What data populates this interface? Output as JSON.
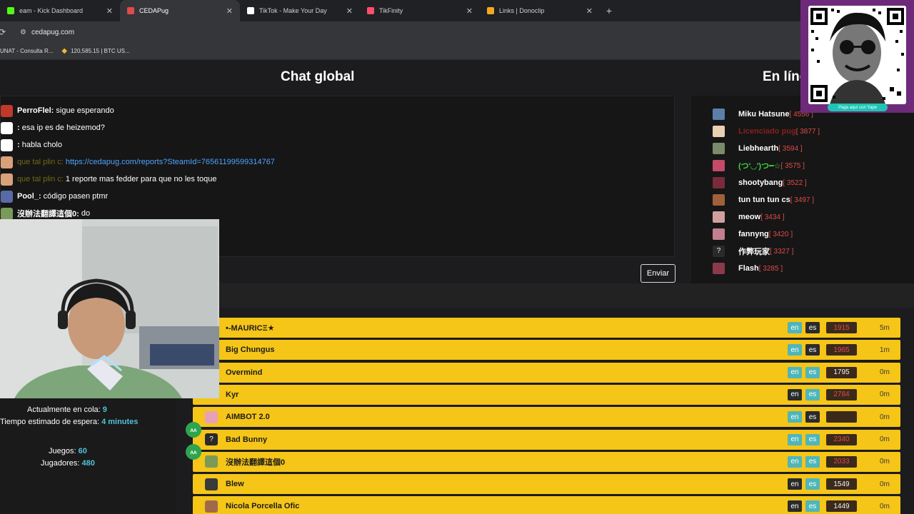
{
  "tabs": [
    {
      "label": "eam - Kick Dashboard",
      "icon": "kick-icon",
      "color": "#53fc18"
    },
    {
      "label": "CEDAPug",
      "icon": "cedapug-icon",
      "color": "#e04a4a",
      "active": true
    },
    {
      "label": "TikTok - Make Your Day",
      "icon": "tiktok-icon",
      "color": "#ffffff"
    },
    {
      "label": "TikFinity",
      "icon": "tikfinity-icon",
      "color": "#ff4d6d"
    },
    {
      "label": "Links | Donoclip",
      "icon": "donoclip-icon",
      "color": "#f5a623"
    }
  ],
  "toolbar": {
    "url": "cedapug.com"
  },
  "bookmarks": [
    {
      "label": "UNAT - Consulta R..."
    },
    {
      "label": "120,585.15 | BTC US...",
      "icon": "binance-icon"
    }
  ],
  "chat": {
    "title": "Chat global",
    "send_label": "Enviar",
    "messages": [
      {
        "user": "PerroFlel:",
        "text": " sigue esperando",
        "avatar_color": "#c0392b"
      },
      {
        "user": ":",
        "text": " esa ip es de heizemod?",
        "avatar_color": "#ffffff"
      },
      {
        "user": ":",
        "text": " habla cholo",
        "avatar_color": "#ffffff"
      },
      {
        "user": "que tal plin c:",
        "text": " https://cedapug.com/reports?SteamId=76561199599314767",
        "avatar_color": "#d9a17a",
        "olive": true,
        "link": true
      },
      {
        "user": "que tal plin c:",
        "text": " 1 reporte mas fedder para que no les toque",
        "avatar_color": "#d9a17a",
        "olive": true
      },
      {
        "user": "Pool_:",
        "text": " código pasen ptmr",
        "avatar_color": "#5a6aa8"
      },
      {
        "user": "沒辦法翻譯這個0:",
        "text": " do",
        "avatar_color": "#7a9a5a"
      }
    ]
  },
  "online": {
    "title": "En líne",
    "users": [
      {
        "name": "Miku Hatsune",
        "score": "[ 4556 ]",
        "color": "#ffffff",
        "avatar_color": "#5b7fa8"
      },
      {
        "name": "Licenciado pug",
        "score": "[ 3877 ]",
        "color": "#8a1e1e",
        "avatar_color": "#e8d0b0"
      },
      {
        "name": "Liebhearth",
        "score": "[ 3594 ]",
        "color": "#ffffff",
        "avatar_color": "#7a8a6a"
      },
      {
        "name": "(つ'◡')つ━☆",
        "score": "[ 3575 ]",
        "color": "#3ed43e",
        "avatar_color": "#c44a6a"
      },
      {
        "name": "shootybang",
        "score": "[ 3522 ]",
        "color": "#ffffff",
        "avatar_color": "#7a2a3a"
      },
      {
        "name": "tun tun tun cs",
        "score": "[ 3497 ]",
        "color": "#ffffff",
        "avatar_color": "#a0603a"
      },
      {
        "name": "meow",
        "score": "[ 3434 ]",
        "color": "#ffffff",
        "avatar_color": "#d0a0a0"
      },
      {
        "name": "fannyng",
        "score": "[ 3420 ]",
        "color": "#ffffff",
        "avatar_color": "#c08090"
      },
      {
        "name": "作弊玩家",
        "score": "[ 3327 ]",
        "color": "#ffffff",
        "avatar_color": "#2a2a2a",
        "glyph": "?"
      },
      {
        "name": "Flash",
        "score": "[ 3285 ]",
        "color": "#ffffff",
        "avatar_color": "#8a3a4a"
      }
    ]
  },
  "queue": {
    "rows": [
      {
        "name": "•-MAURICΞ★",
        "lang1": "en",
        "lang1_style": "teal",
        "lang2": "es",
        "lang2_style": "dark",
        "elo": "1915",
        "elo_style": "red",
        "time": "5m",
        "avatar_color": ""
      },
      {
        "name": "Big Chungus",
        "lang1": "en",
        "lang1_style": "teal",
        "lang2": "es",
        "lang2_style": "dark",
        "elo": "1965",
        "elo_style": "red",
        "time": "1m",
        "avatar_color": ""
      },
      {
        "name": "Overmind",
        "lang1": "en",
        "lang1_style": "teal",
        "lang2": "es",
        "lang2_style": "teal",
        "elo": "1795",
        "elo_style": "white",
        "time": "0m",
        "avatar_color": ""
      },
      {
        "name": "Kyr",
        "lang1": "en",
        "lang1_style": "dark",
        "lang2": "es",
        "lang2_style": "teal",
        "elo": "2784",
        "elo_style": "red",
        "time": "0m",
        "avatar_color": ""
      },
      {
        "name": "AIMBOT 2.0",
        "lang1": "en",
        "lang1_style": "teal",
        "lang2": "es",
        "lang2_style": "dark",
        "elo": "",
        "elo_style": "red",
        "time": "0m",
        "avatar_color": "#e8a0b8"
      },
      {
        "name": "Bad Bunny",
        "lang1": "en",
        "lang1_style": "teal",
        "lang2": "es",
        "lang2_style": "teal",
        "elo": "2340",
        "elo_style": "red",
        "time": "0m",
        "avatar_color": "#2a2a2a",
        "glyph": "?"
      },
      {
        "name": "沒辦法翻譯這個0",
        "lang1": "en",
        "lang1_style": "teal",
        "lang2": "es",
        "lang2_style": "teal",
        "elo": "2033",
        "elo_style": "red",
        "time": "0m",
        "avatar_color": "#7a9a5a"
      },
      {
        "name": "Blew",
        "lang1": "en",
        "lang1_style": "dark",
        "lang2": "es",
        "lang2_style": "teal",
        "elo": "1549",
        "elo_style": "white",
        "time": "0m",
        "avatar_color": "#3a3a3a"
      },
      {
        "name": "Nicola Porcella Ofic",
        "lang1": "en",
        "lang1_style": "dark",
        "lang2": "es",
        "lang2_style": "teal",
        "elo": "1449",
        "elo_style": "white",
        "time": "0m",
        "avatar_color": "#a06a4a"
      }
    ]
  },
  "stats": {
    "queue_label": "Actualmente en cola:",
    "queue_value": "9",
    "wait_label": "Tiempo estimado de espera:",
    "wait_value": "4 minutes",
    "games_label": "Juegos:",
    "games_value": "60",
    "players_label": "Jugadores:",
    "players_value": "480"
  },
  "qr": {
    "caption": "Paga aquí con Yape"
  }
}
